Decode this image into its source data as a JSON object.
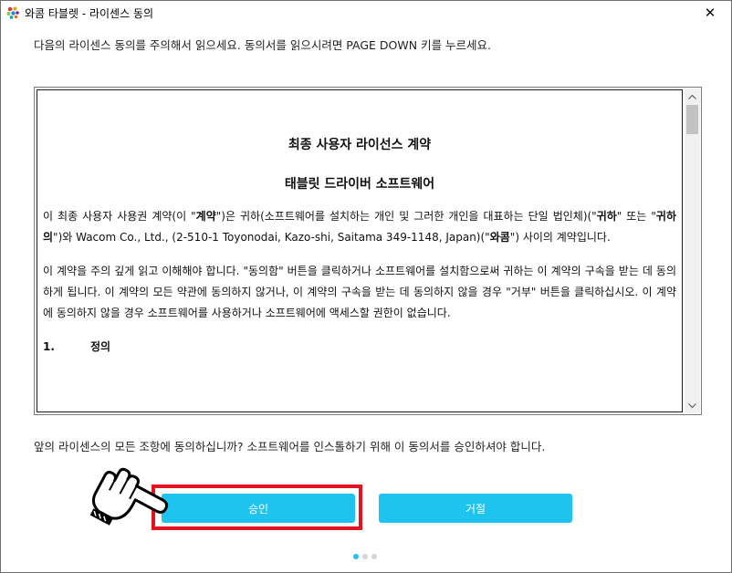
{
  "window": {
    "title": "와콤 타블렛 - 라이센스 동의",
    "close_symbol": "✕"
  },
  "instruction": "다음의 라이센스 동의를 주의해서 읽으세요.  동의서를 읽으시려면 PAGE DOWN 키를 누르세요.",
  "license": {
    "title": "최종 사용자 라이선스 계약",
    "subtitle": "태블릿 드라이버 소프트웨어",
    "para1": {
      "t1": "이 최종 사용자 사용권 계약(이 \"",
      "b1": "계약",
      "t2": "\")은 귀하(소프트웨어를 설치하는 개인 및 그러한 개인을 대표하는 단일 법인체)(\"",
      "b2": "귀하",
      "t3": "\" 또는 \"",
      "b3": "귀하의",
      "t4": "\")와 Wacom Co., Ltd., (2-510-1 Toyonodai, Kazo-shi, Saitama 349-1148, Japan)(\"",
      "b4": "와콤",
      "t5": "\") 사이의 계약입니다."
    },
    "para2": "이 계약을 주의 깊게 읽고 이해해야 합니다. \"동의함\" 버튼을 클릭하거나 소프트웨어를 설치함으로써 귀하는 이 계약의 구속을 받는 데 동의하게 됩니다. 이 계약의 모든 약관에 동의하지 않거나, 이 계약의 구속을 받는 데 동의하지 않을 경우 \"거부\" 버튼을 클릭하십시오. 이 계약에 동의하지 않을 경우 소프트웨어를 사용하거나 소프트웨어에 액세스할 권한이 없습니다.",
    "section1_num": "1.",
    "section1_title": "정의"
  },
  "question": "앞의 라이센스의 모든 조항에 동의하십니까?  소프트웨어를 인스톨하기 위해 이 동의서를 승인하셔야 합니다.",
  "buttons": {
    "accept": "승인",
    "decline": "거절"
  },
  "pager": {
    "total": 3,
    "active": 1
  },
  "colors": {
    "accent": "#1ec3ee",
    "highlight": "#e2141e"
  },
  "icons": {
    "app": "wacom-logo-icon",
    "close": "close-icon",
    "cursor": "hand-pointer-icon"
  }
}
